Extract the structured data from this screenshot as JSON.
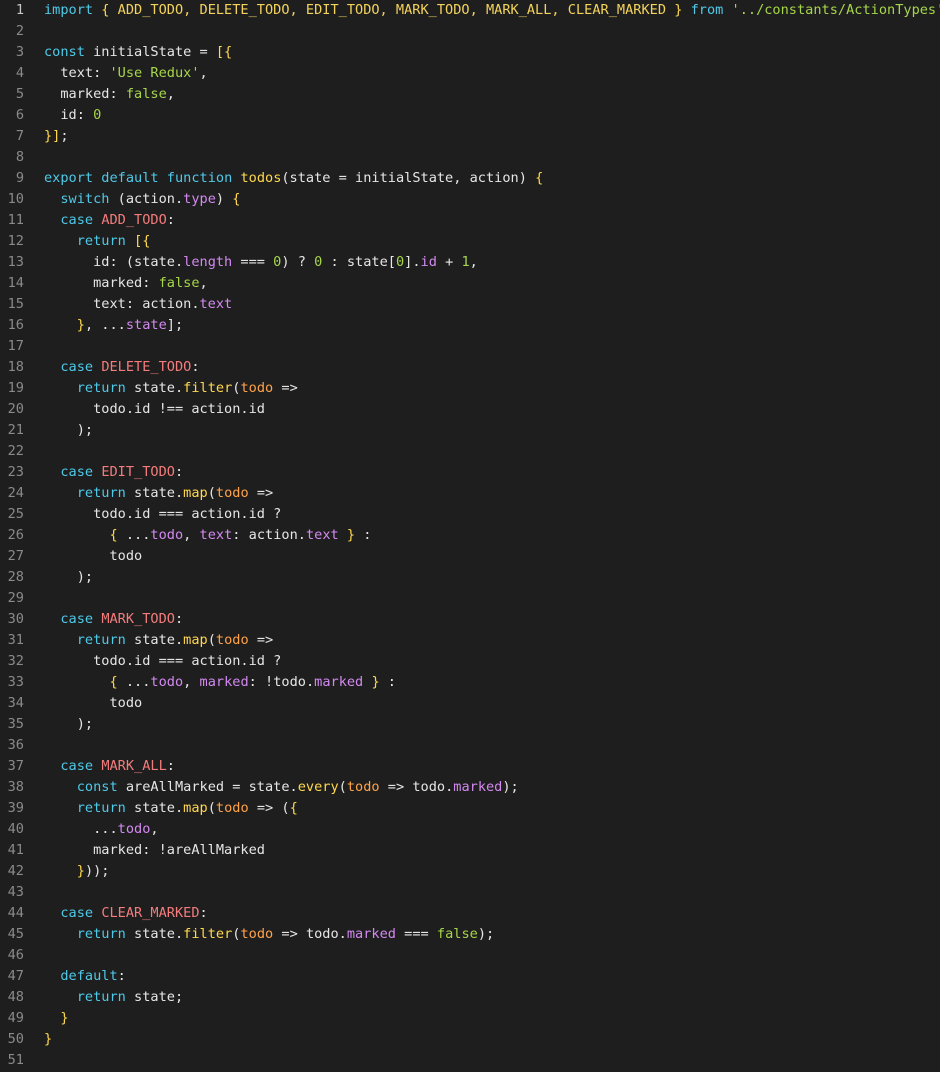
{
  "editor": {
    "lines": [
      {
        "n": "1",
        "tokens": [
          {
            "t": "import",
            "k": "k"
          },
          {
            "t": " "
          },
          {
            "t": "{",
            "k": "c"
          },
          {
            "t": " ADD_TODO, DELETE_TODO, EDIT_TODO, MARK_TODO, MARK_ALL, CLEAR_MARKED ",
            "k": "i"
          },
          {
            "t": "}",
            "k": "c"
          },
          {
            "t": " "
          },
          {
            "t": "from",
            "k": "k"
          },
          {
            "t": " "
          },
          {
            "t": "'../constants/ActionTypes'",
            "k": "s"
          },
          {
            "t": ";"
          }
        ]
      },
      {
        "n": "2",
        "tokens": []
      },
      {
        "n": "3",
        "tokens": [
          {
            "t": "const",
            "k": "k"
          },
          {
            "t": " initialState = "
          },
          {
            "t": "[{",
            "k": "c"
          }
        ]
      },
      {
        "n": "4",
        "tokens": [
          {
            "t": "  text: "
          },
          {
            "t": "'Use Redux'",
            "k": "s"
          },
          {
            "t": ","
          }
        ]
      },
      {
        "n": "5",
        "tokens": [
          {
            "t": "  marked: "
          },
          {
            "t": "false",
            "k": "b"
          },
          {
            "t": ","
          }
        ]
      },
      {
        "n": "6",
        "tokens": [
          {
            "t": "  id: "
          },
          {
            "t": "0",
            "k": "n"
          }
        ]
      },
      {
        "n": "7",
        "tokens": [
          {
            "t": "}]",
            "k": "c"
          },
          {
            "t": ";"
          }
        ]
      },
      {
        "n": "8",
        "tokens": []
      },
      {
        "n": "9",
        "tokens": [
          {
            "t": "export",
            "k": "k"
          },
          {
            "t": " "
          },
          {
            "t": "default",
            "k": "k"
          },
          {
            "t": " "
          },
          {
            "t": "function",
            "k": "k"
          },
          {
            "t": " "
          },
          {
            "t": "todos",
            "k": "f"
          },
          {
            "t": "(state = initialState, action) "
          },
          {
            "t": "{",
            "k": "c"
          }
        ]
      },
      {
        "n": "10",
        "tokens": [
          {
            "t": "  "
          },
          {
            "t": "switch",
            "k": "k"
          },
          {
            "t": " (action."
          },
          {
            "t": "type",
            "k": "p"
          },
          {
            "t": ") "
          },
          {
            "t": "{",
            "k": "c"
          }
        ]
      },
      {
        "n": "11",
        "tokens": [
          {
            "t": "  "
          },
          {
            "t": "case",
            "k": "k"
          },
          {
            "t": " "
          },
          {
            "t": "ADD_TODO",
            "k": "r"
          },
          {
            "t": ":"
          }
        ]
      },
      {
        "n": "12",
        "tokens": [
          {
            "t": "    "
          },
          {
            "t": "return",
            "k": "k"
          },
          {
            "t": " "
          },
          {
            "t": "[{",
            "k": "c"
          }
        ]
      },
      {
        "n": "13",
        "tokens": [
          {
            "t": "      id: (state."
          },
          {
            "t": "length",
            "k": "p"
          },
          {
            "t": " === "
          },
          {
            "t": "0",
            "k": "n"
          },
          {
            "t": ") ? "
          },
          {
            "t": "0",
            "k": "n"
          },
          {
            "t": " : state["
          },
          {
            "t": "0",
            "k": "n"
          },
          {
            "t": "]."
          },
          {
            "t": "id",
            "k": "p"
          },
          {
            "t": " + "
          },
          {
            "t": "1",
            "k": "n"
          },
          {
            "t": ","
          }
        ]
      },
      {
        "n": "14",
        "tokens": [
          {
            "t": "      marked: "
          },
          {
            "t": "false",
            "k": "b"
          },
          {
            "t": ","
          }
        ]
      },
      {
        "n": "15",
        "tokens": [
          {
            "t": "      text: action."
          },
          {
            "t": "text",
            "k": "p"
          }
        ]
      },
      {
        "n": "16",
        "tokens": [
          {
            "t": "    "
          },
          {
            "t": "}",
            "k": "c"
          },
          {
            "t": ", ..."
          },
          {
            "t": "state",
            "k": "p"
          },
          {
            "t": "];"
          }
        ]
      },
      {
        "n": "17",
        "tokens": []
      },
      {
        "n": "18",
        "tokens": [
          {
            "t": "  "
          },
          {
            "t": "case",
            "k": "k"
          },
          {
            "t": " "
          },
          {
            "t": "DELETE_TODO",
            "k": "r"
          },
          {
            "t": ":"
          }
        ]
      },
      {
        "n": "19",
        "tokens": [
          {
            "t": "    "
          },
          {
            "t": "return",
            "k": "k"
          },
          {
            "t": " state."
          },
          {
            "t": "filter",
            "k": "f"
          },
          {
            "t": "("
          },
          {
            "t": "todo",
            "k": "a"
          },
          {
            "t": " =>"
          }
        ]
      },
      {
        "n": "20",
        "tokens": [
          {
            "t": "      todo.id !== action.id"
          }
        ]
      },
      {
        "n": "21",
        "tokens": [
          {
            "t": "    );"
          }
        ]
      },
      {
        "n": "22",
        "tokens": []
      },
      {
        "n": "23",
        "tokens": [
          {
            "t": "  "
          },
          {
            "t": "case",
            "k": "k"
          },
          {
            "t": " "
          },
          {
            "t": "EDIT_TODO",
            "k": "r"
          },
          {
            "t": ":"
          }
        ]
      },
      {
        "n": "24",
        "tokens": [
          {
            "t": "    "
          },
          {
            "t": "return",
            "k": "k"
          },
          {
            "t": " state."
          },
          {
            "t": "map",
            "k": "f"
          },
          {
            "t": "("
          },
          {
            "t": "todo",
            "k": "a"
          },
          {
            "t": " =>"
          }
        ]
      },
      {
        "n": "25",
        "tokens": [
          {
            "t": "      todo.id === action.id ?"
          }
        ]
      },
      {
        "n": "26",
        "tokens": [
          {
            "t": "        "
          },
          {
            "t": "{",
            "k": "c"
          },
          {
            "t": " ..."
          },
          {
            "t": "todo",
            "k": "p"
          },
          {
            "t": ", "
          },
          {
            "t": "text",
            "k": "p"
          },
          {
            "t": ": action."
          },
          {
            "t": "text",
            "k": "p"
          },
          {
            "t": " "
          },
          {
            "t": "}",
            "k": "c"
          },
          {
            "t": " :"
          }
        ]
      },
      {
        "n": "27",
        "tokens": [
          {
            "t": "        todo"
          }
        ]
      },
      {
        "n": "28",
        "tokens": [
          {
            "t": "    );"
          }
        ]
      },
      {
        "n": "29",
        "tokens": []
      },
      {
        "n": "30",
        "tokens": [
          {
            "t": "  "
          },
          {
            "t": "case",
            "k": "k"
          },
          {
            "t": " "
          },
          {
            "t": "MARK_TODO",
            "k": "r"
          },
          {
            "t": ":"
          }
        ]
      },
      {
        "n": "31",
        "tokens": [
          {
            "t": "    "
          },
          {
            "t": "return",
            "k": "k"
          },
          {
            "t": " state."
          },
          {
            "t": "map",
            "k": "f"
          },
          {
            "t": "("
          },
          {
            "t": "todo",
            "k": "a"
          },
          {
            "t": " =>"
          }
        ]
      },
      {
        "n": "32",
        "tokens": [
          {
            "t": "      todo.id === action.id ?"
          }
        ]
      },
      {
        "n": "33",
        "tokens": [
          {
            "t": "        "
          },
          {
            "t": "{",
            "k": "c"
          },
          {
            "t": " ..."
          },
          {
            "t": "todo",
            "k": "p"
          },
          {
            "t": ", "
          },
          {
            "t": "marked",
            "k": "p"
          },
          {
            "t": ": !todo."
          },
          {
            "t": "marked",
            "k": "p"
          },
          {
            "t": " "
          },
          {
            "t": "}",
            "k": "c"
          },
          {
            "t": " :"
          }
        ]
      },
      {
        "n": "34",
        "tokens": [
          {
            "t": "        todo"
          }
        ]
      },
      {
        "n": "35",
        "tokens": [
          {
            "t": "    );"
          }
        ]
      },
      {
        "n": "36",
        "tokens": []
      },
      {
        "n": "37",
        "tokens": [
          {
            "t": "  "
          },
          {
            "t": "case",
            "k": "k"
          },
          {
            "t": " "
          },
          {
            "t": "MARK_ALL",
            "k": "r"
          },
          {
            "t": ":"
          }
        ]
      },
      {
        "n": "38",
        "tokens": [
          {
            "t": "    "
          },
          {
            "t": "const",
            "k": "k"
          },
          {
            "t": " areAllMarked = state."
          },
          {
            "t": "every",
            "k": "f"
          },
          {
            "t": "("
          },
          {
            "t": "todo",
            "k": "a"
          },
          {
            "t": " => todo."
          },
          {
            "t": "marked",
            "k": "p"
          },
          {
            "t": ");"
          }
        ]
      },
      {
        "n": "39",
        "tokens": [
          {
            "t": "    "
          },
          {
            "t": "return",
            "k": "k"
          },
          {
            "t": " state."
          },
          {
            "t": "map",
            "k": "f"
          },
          {
            "t": "("
          },
          {
            "t": "todo",
            "k": "a"
          },
          {
            "t": " => ("
          },
          {
            "t": "{",
            "k": "c"
          }
        ]
      },
      {
        "n": "40",
        "tokens": [
          {
            "t": "      ..."
          },
          {
            "t": "todo",
            "k": "p"
          },
          {
            "t": ","
          }
        ]
      },
      {
        "n": "41",
        "tokens": [
          {
            "t": "      marked: !areAllMarked"
          }
        ]
      },
      {
        "n": "42",
        "tokens": [
          {
            "t": "    "
          },
          {
            "t": "}",
            "k": "c"
          },
          {
            "t": "));"
          }
        ]
      },
      {
        "n": "43",
        "tokens": []
      },
      {
        "n": "44",
        "tokens": [
          {
            "t": "  "
          },
          {
            "t": "case",
            "k": "k"
          },
          {
            "t": " "
          },
          {
            "t": "CLEAR_MARKED",
            "k": "r"
          },
          {
            "t": ":"
          }
        ]
      },
      {
        "n": "45",
        "tokens": [
          {
            "t": "    "
          },
          {
            "t": "return",
            "k": "k"
          },
          {
            "t": " state."
          },
          {
            "t": "filter",
            "k": "f"
          },
          {
            "t": "("
          },
          {
            "t": "todo",
            "k": "a"
          },
          {
            "t": " => todo."
          },
          {
            "t": "marked",
            "k": "p"
          },
          {
            "t": " === "
          },
          {
            "t": "false",
            "k": "b"
          },
          {
            "t": ");"
          }
        ]
      },
      {
        "n": "46",
        "tokens": []
      },
      {
        "n": "47",
        "tokens": [
          {
            "t": "  "
          },
          {
            "t": "default",
            "k": "k"
          },
          {
            "t": ":"
          }
        ]
      },
      {
        "n": "48",
        "tokens": [
          {
            "t": "    "
          },
          {
            "t": "return",
            "k": "k"
          },
          {
            "t": " state;"
          }
        ]
      },
      {
        "n": "49",
        "tokens": [
          {
            "t": "  "
          },
          {
            "t": "}",
            "k": "c"
          }
        ]
      },
      {
        "n": "50",
        "tokens": [
          {
            "t": "}",
            "k": "c"
          }
        ]
      },
      {
        "n": "51",
        "tokens": []
      }
    ],
    "colors": {
      "background": "#1e1e1e",
      "keyword": "#4ec9e8",
      "string": "#a6d64a",
      "brace": "#ffd84d",
      "property": "#d389f0",
      "parameter": "#ffa34a",
      "constant": "#f47c7c",
      "line_number": "#8a8a8a"
    }
  }
}
